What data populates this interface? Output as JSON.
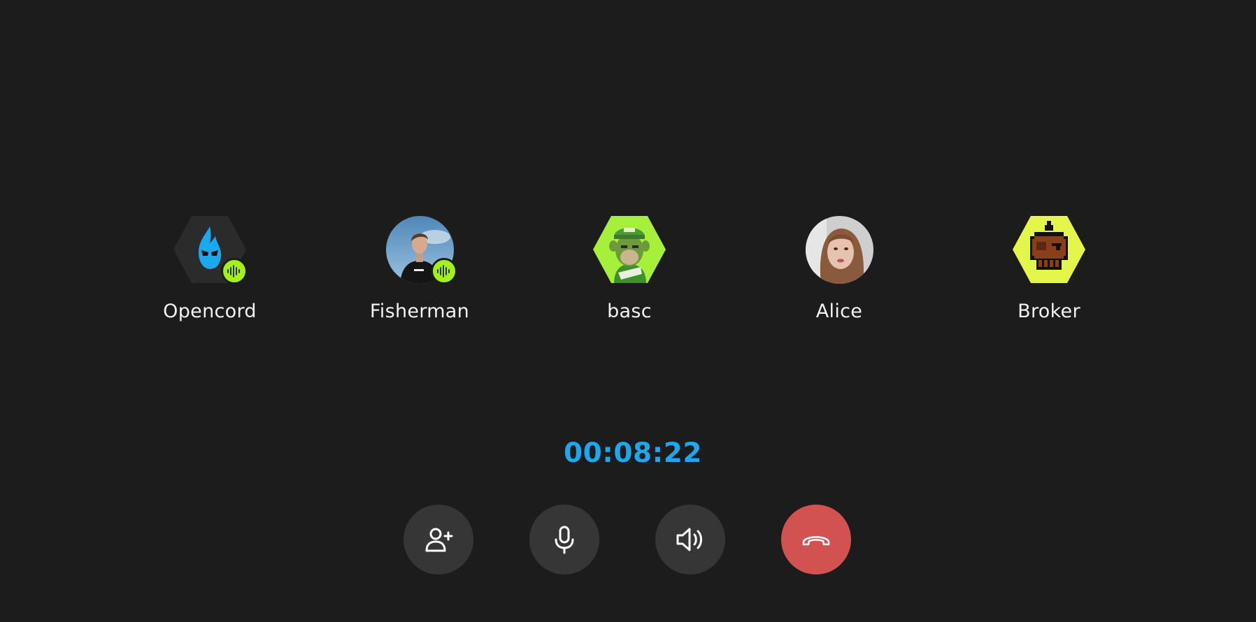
{
  "call": {
    "timer": "00:08:22",
    "accent_color": "#1ea7ea",
    "speaking_color": "#a4f01a",
    "hangup_color": "#d25252"
  },
  "participants": [
    {
      "name": "Opencord",
      "avatar": "flame-mascot-hexagon",
      "speaking": true
    },
    {
      "name": "Fisherman",
      "avatar": "person-photo-round",
      "speaking": true
    },
    {
      "name": "basc",
      "avatar": "green-ape-hexagon",
      "speaking": false
    },
    {
      "name": "Alice",
      "avatar": "person-photo-round",
      "speaking": false
    },
    {
      "name": "Broker",
      "avatar": "pixel-skull-hexagon",
      "speaking": false
    }
  ],
  "controls": [
    {
      "icon": "add-user-icon"
    },
    {
      "icon": "microphone-icon"
    },
    {
      "icon": "speaker-icon"
    },
    {
      "icon": "hang-up-icon"
    }
  ]
}
